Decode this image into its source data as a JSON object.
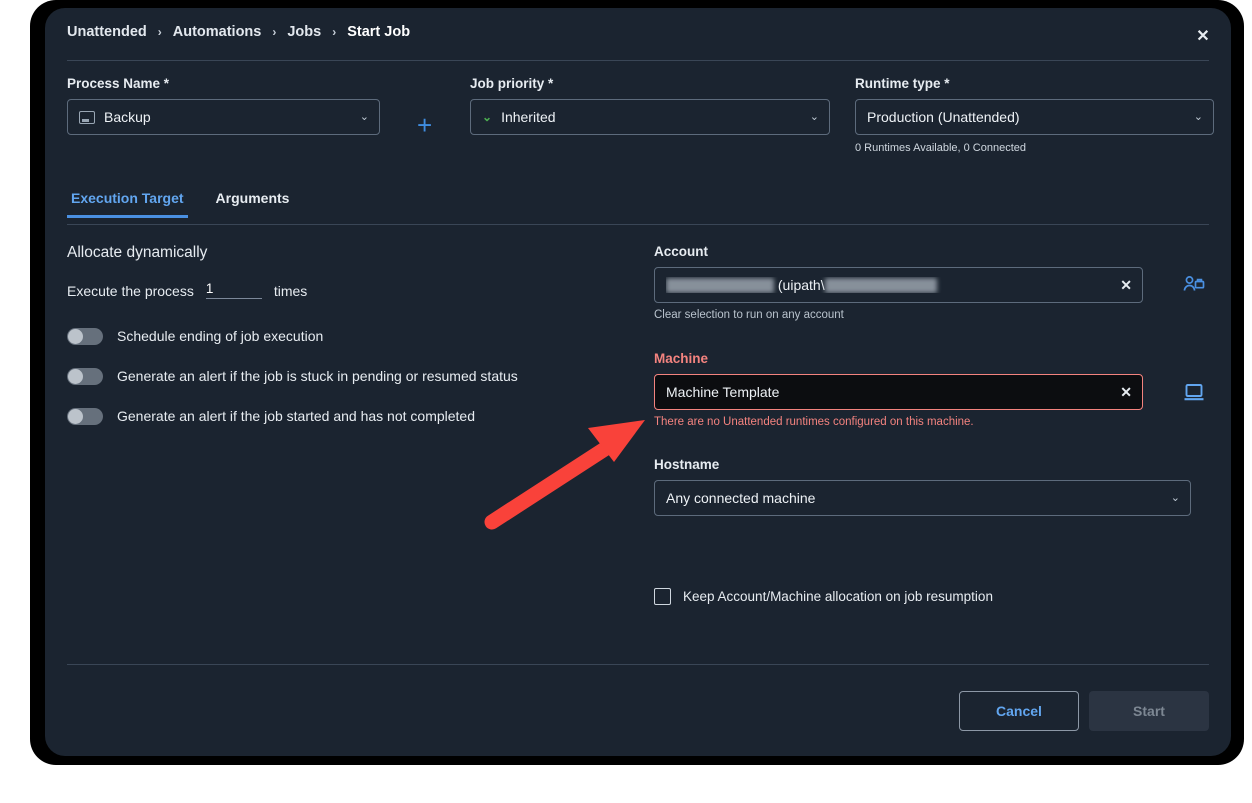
{
  "dialog": {
    "breadcrumb": [
      {
        "label": "Unattended"
      },
      {
        "label": "Automations"
      },
      {
        "label": "Jobs"
      },
      {
        "label": "Start Job"
      }
    ],
    "separator": "›",
    "close_label": "✕"
  },
  "form": {
    "process": {
      "label": "Process Name *",
      "value": "Backup",
      "chevron": "⌄",
      "add_label": "+"
    },
    "priority": {
      "label": "Job priority *",
      "value": "Inherited",
      "status_chevron": "⌄",
      "chevron": "⌄"
    },
    "runtime": {
      "label": "Runtime type *",
      "value": "Production (Unattended)",
      "chevron": "⌄",
      "note": "0 Runtimes Available, 0 Connected"
    }
  },
  "tabs": [
    {
      "label": "Execution Target",
      "active": true
    },
    {
      "label": "Arguments",
      "active": false
    }
  ],
  "execution_target": {
    "allocate_title": "Allocate dynamically",
    "execute_prefix": "Execute the process",
    "execute_count": "1",
    "execute_suffix": "times",
    "toggles": [
      {
        "label": "Schedule ending of job execution",
        "on": false
      },
      {
        "label": "Generate an alert if the job is stuck in pending or resumed status",
        "on": false
      },
      {
        "label": "Generate an alert if the job started and has not completed",
        "on": false
      }
    ]
  },
  "account": {
    "label": "Account",
    "value_middle": "(uipath\\",
    "clear_label": "✕",
    "hint": "Clear selection to run on any account",
    "icon": "account-person-icon"
  },
  "machine": {
    "label": "Machine",
    "value": "Machine Template",
    "clear_label": "✕",
    "error": "There are no Unattended runtimes configured on this machine.",
    "icon": "monitor-icon"
  },
  "hostname": {
    "label": "Hostname",
    "value": "Any connected machine",
    "chevron": "⌄"
  },
  "keep_allocation": {
    "label": "Keep Account/Machine allocation on job resumption",
    "checked": false
  },
  "footer": {
    "cancel_label": "Cancel",
    "start_label": "Start"
  },
  "colors": {
    "accent_blue": "#4a90e2",
    "link_blue": "#62a6f0",
    "error_red": "#f4837f",
    "annotation_red": "#f9423a",
    "priority_green": "#4caf50",
    "dialog_bg": "#1b2430"
  }
}
